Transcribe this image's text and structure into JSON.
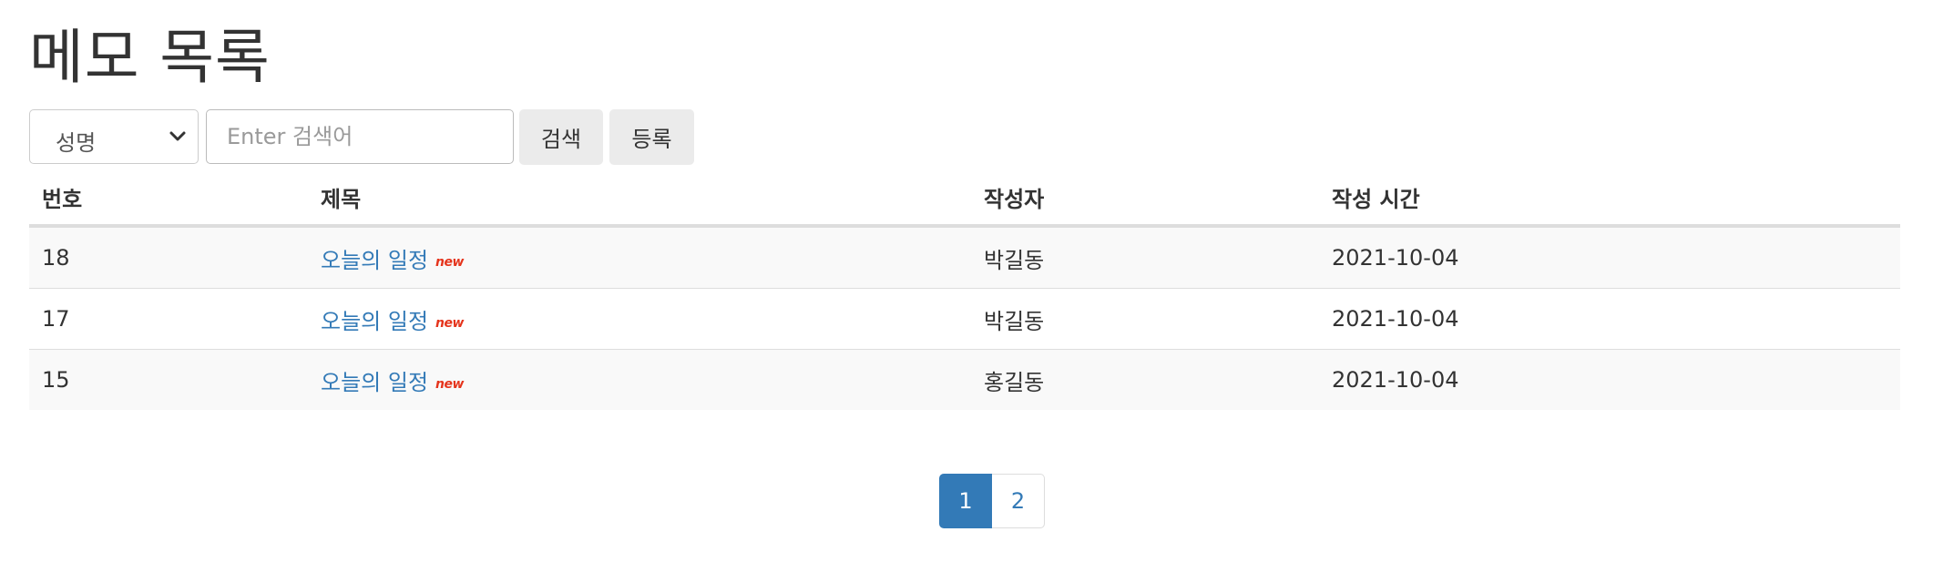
{
  "page": {
    "title": "메모 목록"
  },
  "search": {
    "field_selected": "성명",
    "placeholder": "Enter 검색어",
    "search_label": "검색",
    "register_label": "등록"
  },
  "table": {
    "headers": [
      "번호",
      "제목",
      "작성자",
      "작성 시간"
    ],
    "rows": [
      {
        "no": "18",
        "title": "오늘의 일정",
        "badge": "new",
        "writer": "박길동",
        "date": "2021-10-04"
      },
      {
        "no": "17",
        "title": "오늘의 일정",
        "badge": "new",
        "writer": "박길동",
        "date": "2021-10-04"
      },
      {
        "no": "15",
        "title": "오늘의 일정",
        "badge": "new",
        "writer": "홍길동",
        "date": "2021-10-04"
      }
    ]
  },
  "pagination": {
    "pages": [
      "1",
      "2"
    ],
    "current": "1"
  },
  "colors": {
    "link": "#337ab7",
    "badge": "#e5341c",
    "button_bg": "#ebebeb"
  }
}
